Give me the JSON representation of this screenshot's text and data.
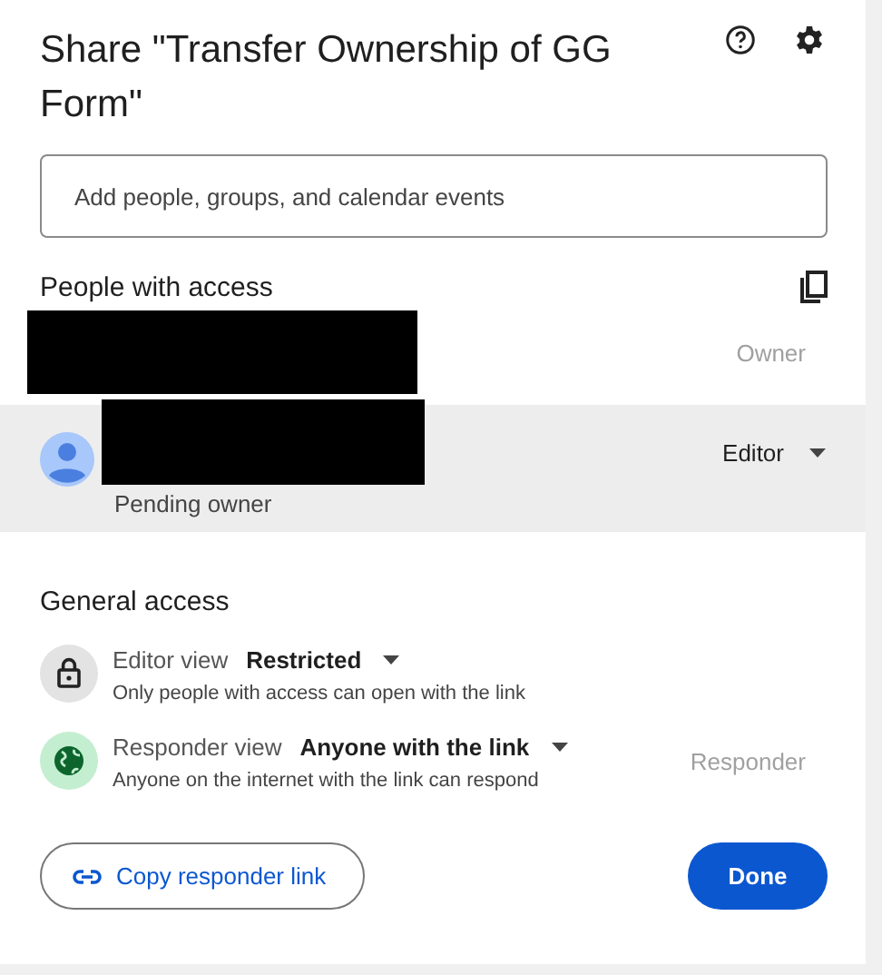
{
  "dialog": {
    "title": "Share \"Transfer Ownership of GG Form\""
  },
  "add_field": {
    "placeholder": "Add people, groups, and calendar events"
  },
  "people_section": {
    "heading": "People with access"
  },
  "people": [
    {
      "name_redacted": true,
      "avatar": false,
      "selected": false,
      "role": {
        "label": "Owner",
        "disabled": true
      }
    },
    {
      "name_redacted": true,
      "avatar": true,
      "selected": true,
      "note": "Pending owner",
      "role": {
        "label": "Editor",
        "disabled": false
      }
    }
  ],
  "general_access": {
    "heading": "General access",
    "rows": [
      {
        "kind": "lock",
        "label": "Editor view",
        "value": "Restricted",
        "description": "Only people with access can open with the link",
        "role": null
      },
      {
        "kind": "globe",
        "label": "Responder view",
        "value": "Anyone with the link",
        "description": "Anyone on the internet with the link can respond",
        "role": "Responder"
      }
    ]
  },
  "buttons": {
    "copy_link": "Copy responder link",
    "done": "Done"
  }
}
